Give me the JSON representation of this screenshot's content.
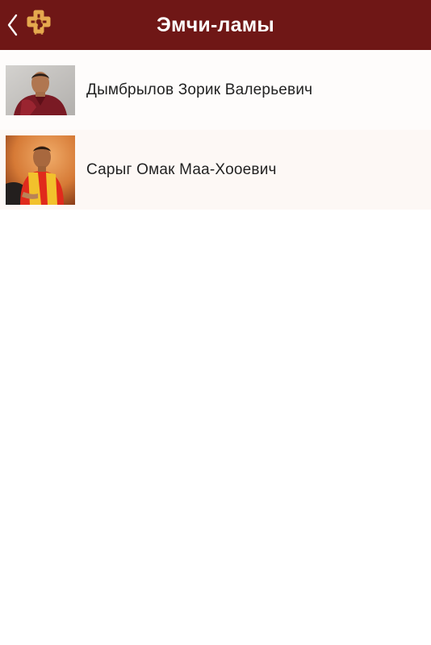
{
  "header": {
    "title": "Эмчи-ламы",
    "back_icon": "chevron-left-icon",
    "logo_icon": "endless-knot-logo"
  },
  "colors": {
    "navbar": "#6f1716",
    "logo": "#e5a94e",
    "row_odd": "#fefcfb",
    "row_even": "#fdf8f5"
  },
  "lamas": [
    {
      "name": "Дымбрылов Зорик Валерьевич",
      "photo": "portrait-photo-maroon-robe"
    },
    {
      "name": "Сарыг Омак Маа-Хооевич",
      "photo": "portrait-photo-yellow-red-robe"
    }
  ]
}
